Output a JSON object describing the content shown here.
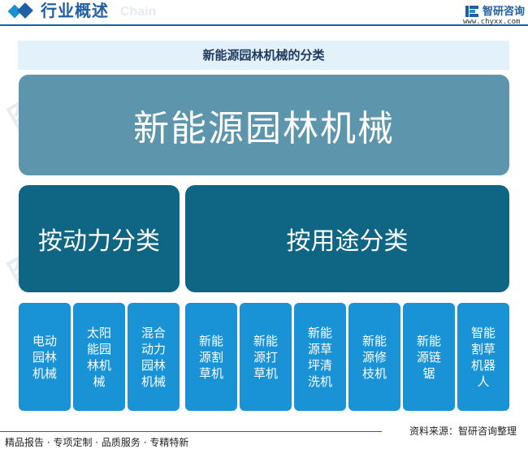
{
  "header": {
    "title": "行业概述",
    "watermark": "Chain",
    "logo_name": "智研咨询",
    "logo_url": "www.chyxx.com"
  },
  "diagram": {
    "subtitle": "新能源园林机械的分类",
    "root": "新能源园林机械",
    "categories": {
      "by_power": "按动力分类",
      "by_use": "按用途分类"
    },
    "leaves": [
      "电动园林机械",
      "太阳能园林机械",
      "混合动力园林机械",
      "新能源割草机",
      "新能源打草机",
      "新能源草坪清洗机",
      "新能源修枝机",
      "新能源链锯",
      "智能割草机器人"
    ]
  },
  "footer": {
    "tagline": "精品报告 · 专项定制 · 品质服务 · 专精特新",
    "source": "资料来源：智研咨询整理"
  },
  "colors": {
    "brand": "#1f5fa3",
    "root_box": "#5d95ad",
    "category_box": "#0f6584",
    "leaf_box": "#1a92d6",
    "subtitle_band": "#e3f1fb"
  }
}
